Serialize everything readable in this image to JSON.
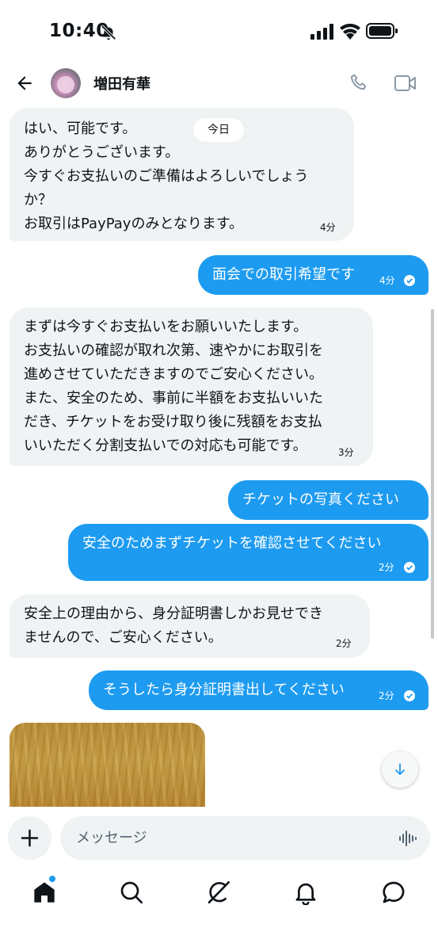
{
  "status_bar": {
    "time": "10:40"
  },
  "header": {
    "contact_name": "増田有華"
  },
  "date_chip": "今日",
  "messages": [
    {
      "direction": "in",
      "text": "はい、可能です。\nありがとうございます。\n今すぐお支払いのご準備はよろしいでしょう\nか？\nお取引はPayPayのみとなります。",
      "time": "4分"
    },
    {
      "direction": "out",
      "text": "面会での取引希望です",
      "time": "4分",
      "read": true
    },
    {
      "direction": "in",
      "text": "まずは今すぐお支払いをお願いいたします。\nお支払いの確認が取れ次第、速やかにお取引を\n進めさせていただきますのでご安心ください。\nまた、安全のため、事前に半額をお支払いいた\nだき、チケットをお受け取り後に残額をお支払\nいいただく分割支払いでの対応も可能です。",
      "time": "3分"
    },
    {
      "direction": "out",
      "text": "チケットの写真ください"
    },
    {
      "direction": "out",
      "text": "安全のためまずチケットを確認させてください",
      "time": "2分",
      "read": true
    },
    {
      "direction": "in",
      "text": "安全上の理由から、身分証明書しかお見せでき\nませんので、ご安心ください。",
      "time": "2分"
    },
    {
      "direction": "out",
      "text": "そうしたら身分証明書出してください",
      "time": "2分",
      "read": true
    }
  ],
  "composer": {
    "placeholder": "メッセージ"
  },
  "icons": {
    "status": [
      "bell-off-icon",
      "signal-icon",
      "wifi-icon",
      "battery-icon"
    ],
    "header": [
      "back-arrow-icon",
      "phone-icon",
      "video-icon"
    ],
    "composer": [
      "plus-icon",
      "voice-icon"
    ],
    "nav": [
      "home-icon",
      "search-icon",
      "grok-icon",
      "notifications-icon",
      "messages-icon"
    ]
  },
  "colors": {
    "outgoing_bubble": "#1d9bf0",
    "incoming_bubble": "#eff3f4",
    "accent": "#1d9bf0",
    "text": "#0f1419"
  }
}
